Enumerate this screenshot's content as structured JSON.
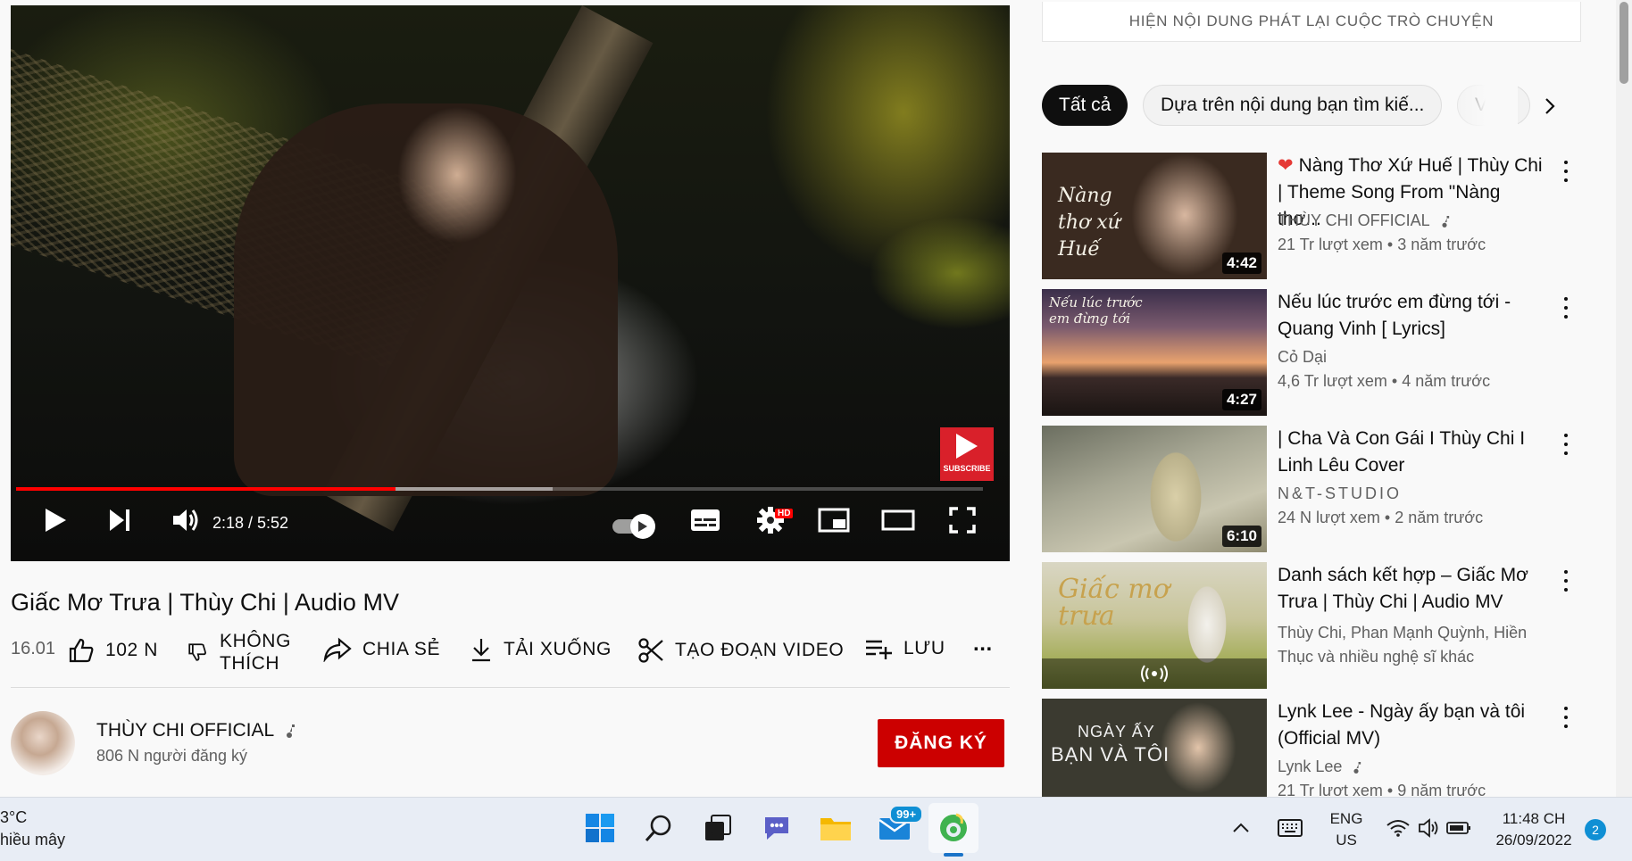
{
  "player": {
    "current_time": "2:18",
    "duration": "5:52",
    "time_display": "2:18 / 5:52",
    "played_fraction": 0.392,
    "buffered_fraction": 0.555,
    "hd_badge": "HD",
    "subscribe_watermark": "SUBSCRIBE"
  },
  "video": {
    "title": "Giấc Mơ Trưa | Thùy Chi | Audio MV",
    "date": "16.01",
    "like_count": "102 N",
    "dislike_label_line1": "KHÔNG",
    "dislike_label_line2": "THÍCH",
    "share_label": "CHIA SẺ",
    "download_label": "TẢI XUỐNG",
    "clip_label": "TẠO ĐOẠN VIDEO",
    "save_label": "LƯU",
    "more_label": "..."
  },
  "channel": {
    "name": "THÙY CHI OFFICIAL",
    "subscribers": "806 N người đăng ký",
    "subscribe_button": "ĐĂNG KÝ"
  },
  "sidebar": {
    "chat_replay": "HIỆN NỘI DUNG PHÁT LẠI CUỘC TRÒ CHUYỆN",
    "chips": [
      "Tất cả",
      "Dựa trên nội dung bạn tìm kiế...",
      "Vide"
    ],
    "recommendations": [
      {
        "heart": "❤",
        "title": "Nàng Thơ Xứ Huế | Thùy Chi | Theme Song From \"Nàng thơ...",
        "channel": "THÙY CHI OFFICIAL",
        "views": "21 Tr lượt xem",
        "age": "3 năm trước",
        "duration": "4:42",
        "thumb_text": "Nàng thơ xứ Huế"
      },
      {
        "title": "Nếu lúc trước em đừng tới - Quang Vinh [ Lyrics]",
        "channel": "Cỏ Dại",
        "views": "4,6 Tr lượt xem",
        "age": "4 năm trước",
        "duration": "4:27",
        "thumb_text": "Nếu lúc trước em đừng tới"
      },
      {
        "title": "| Cha Và Con Gái I Thùy Chi I Linh Lêu Cover",
        "channel": "N&T-STUDIO",
        "views": "24 N lượt xem",
        "age": "2 năm trước",
        "duration": "6:10"
      },
      {
        "title": "Danh sách kết hợp – Giấc Mơ Trưa | Thùy Chi | Audio MV",
        "channel_line1": "Thùy Chi, Phan Mạnh Quỳnh, Hiền",
        "channel_line2": "Thục và nhiều nghệ sĩ khác",
        "thumb_text": "Giấc mơ trưa"
      },
      {
        "title": "Lynk Lee - Ngày ấy bạn và tôi (Official MV)",
        "channel": "Lynk Lee",
        "views": "21 Tr lượt xem",
        "age": "9 năm trước",
        "thumb_text_line1": "NGÀY ẤY",
        "thumb_text_line2": "BẠN VÀ TÔI"
      }
    ]
  },
  "taskbar": {
    "weather_temp": "3°C",
    "weather_desc": "hiều mây",
    "language_line1": "ENG",
    "language_line2": "US",
    "time": "11:48 CH",
    "date": "26/09/2022",
    "mail_badge": "99+",
    "notification_count": "2"
  },
  "colors": {
    "accent_red": "#cc0000",
    "progress_red": "#ff0000",
    "taskbar_bg": "#e8edf5"
  }
}
